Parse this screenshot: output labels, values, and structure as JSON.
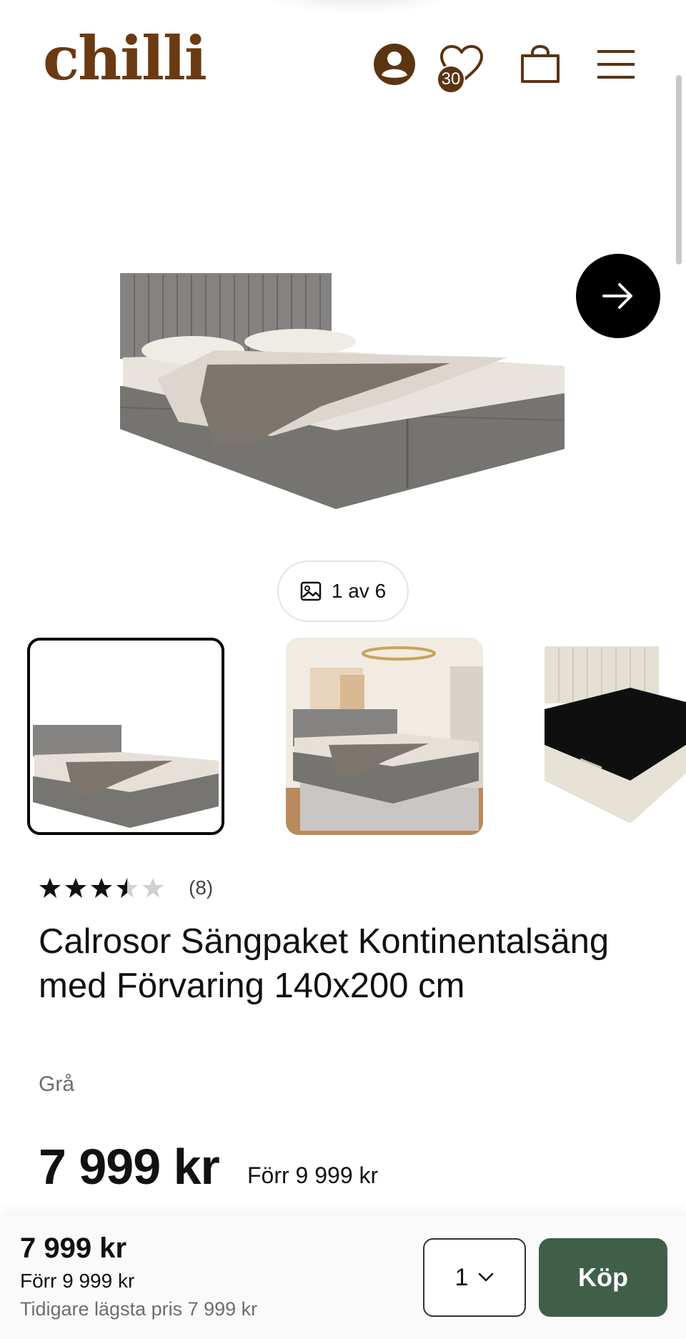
{
  "header": {
    "logo_text": "chilli",
    "wishlist_count": "30",
    "brand_color": "#6b3a12"
  },
  "icons": {
    "account": "user-circle-icon",
    "wishlist": "heart-icon",
    "cart": "shopping-bag-icon",
    "menu": "hamburger-menu-icon",
    "next": "arrow-right-icon",
    "gallery": "image-icon",
    "chevron": "chevron-down-icon"
  },
  "gallery": {
    "counter": "1 av 6",
    "thumbnail_count_visible": 3
  },
  "product": {
    "rating": 3.5,
    "rating_max": 5,
    "review_count": "(8)",
    "title": "Calrosor Sängpaket Kontinentalsäng med Förvaring 140x200 cm",
    "variant": "Grå",
    "price": "7 999 kr",
    "old_price": "Förr 9 999 kr"
  },
  "sticky_bar": {
    "price": "7 999 kr",
    "old_price": "Förr 9 999 kr",
    "lowest_price": "Tidigare lägsta pris 7 999 kr",
    "quantity": "1",
    "buy_label": "Köp",
    "buy_color": "#3f5f49"
  }
}
